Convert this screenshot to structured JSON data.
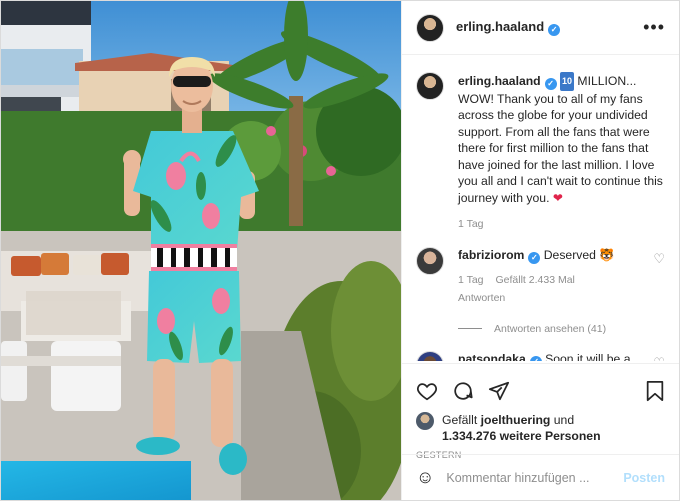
{
  "post": {
    "username": "erling.haaland",
    "verified_mark": "✓",
    "more_icon": "more-dots-icon"
  },
  "caption": {
    "username": "erling.haaland",
    "badge": "10",
    "text": "MILLION... WOW! Thank you to all of my fans across the globe for your undivided support. From all the fans that were there for first million to the fans that have joined for the last million. I love you all and I can't wait to continue this journey with you.",
    "heart": "❤",
    "time": "1 Tag"
  },
  "comments": [
    {
      "username": "fabriziorom",
      "text": "Deserved",
      "emoji": "🐯",
      "time": "1 Tag",
      "likes": "Gefällt 2.433 Mal",
      "reply": "Antworten",
      "view_replies": "Antworten ansehen (41)"
    },
    {
      "username": "patsondaka",
      "text": "Soon it will be a"
    }
  ],
  "actions": {
    "liked_prefix": "Gefällt",
    "liked_user": "joelthuering",
    "liked_and": "und",
    "liked_count": "1.334.276 weitere Personen",
    "date": "GESTERN"
  },
  "comment_box": {
    "placeholder": "Kommentar hinzufügen ...",
    "post_label": "Posten"
  },
  "colors": {
    "verified": "#3897f0",
    "heart": "#e0244b",
    "post_disabled": "#b2dffc"
  }
}
